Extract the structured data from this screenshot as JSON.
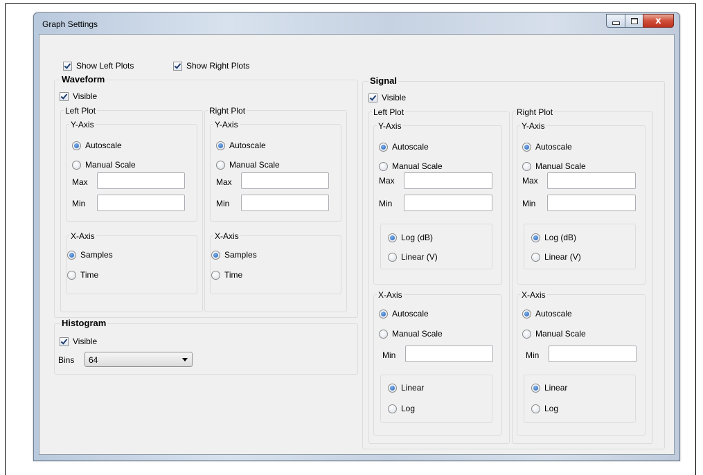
{
  "window": {
    "title": "Graph Settings",
    "minimize_icon": "minimize-icon",
    "maximize_icon": "maximize-icon",
    "close_glyph": "x"
  },
  "top": {
    "show_left_plots": "Show Left Plots",
    "show_right_plots": "Show Right Plots"
  },
  "waveform": {
    "title": "Waveform",
    "visible": "Visible",
    "left": {
      "title": "Left Plot",
      "yaxis": {
        "title": "Y-Axis",
        "autoscale": "Autoscale",
        "manual": "Manual Scale",
        "max": "Max",
        "min": "Min",
        "max_value": "",
        "min_value": ""
      },
      "xaxis": {
        "title": "X-Axis",
        "samples": "Samples",
        "time": "Time"
      }
    },
    "right": {
      "title": "Right Plot",
      "yaxis": {
        "title": "Y-Axis",
        "autoscale": "Autoscale",
        "manual": "Manual Scale",
        "max": "Max",
        "min": "Min",
        "max_value": "",
        "min_value": ""
      },
      "xaxis": {
        "title": "X-Axis",
        "samples": "Samples",
        "time": "Time"
      }
    }
  },
  "histogram": {
    "title": "Histogram",
    "visible": "Visible",
    "bins_label": "Bins",
    "bins_value": "64"
  },
  "signal": {
    "title": "Signal",
    "visible": "Visible",
    "left": {
      "title": "Left Plot",
      "yaxis": {
        "title": "Y-Axis",
        "autoscale": "Autoscale",
        "manual": "Manual Scale",
        "max": "Max",
        "min": "Min",
        "log": "Log (dB)",
        "linear": "Linear (V)",
        "max_value": "",
        "min_value": ""
      },
      "xaxis": {
        "title": "X-Axis",
        "autoscale": "Autoscale",
        "manual": "Manual Scale",
        "min": "Min",
        "linear": "Linear",
        "log": "Log",
        "min_value": ""
      }
    },
    "right": {
      "title": "Right Plot",
      "yaxis": {
        "title": "Y-Axis",
        "autoscale": "Autoscale",
        "manual": "Manual Scale",
        "max": "Max",
        "min": "Min",
        "log": "Log (dB)",
        "linear": "Linear (V)",
        "max_value": "",
        "min_value": ""
      },
      "xaxis": {
        "title": "X-Axis",
        "autoscale": "Autoscale",
        "manual": "Manual Scale",
        "min": "Min",
        "linear": "Linear",
        "log": "Log",
        "min_value": ""
      }
    }
  },
  "state": {
    "show_left_plots_checked": true,
    "show_right_plots_checked": true,
    "waveform_visible_checked": true,
    "histogram_visible_checked": true,
    "signal_visible_checked": true,
    "selected_y_scale": "Autoscale",
    "selected_waveform_x": "Samples",
    "selected_signal_y_unit": "Log (dB)",
    "selected_signal_x_scale": "Autoscale",
    "selected_signal_x_mode": "Linear"
  },
  "colors": {
    "dialog_background": "#f0f0f0",
    "close_button": "#c9422c",
    "radio_selected": "#1f5fb8"
  }
}
